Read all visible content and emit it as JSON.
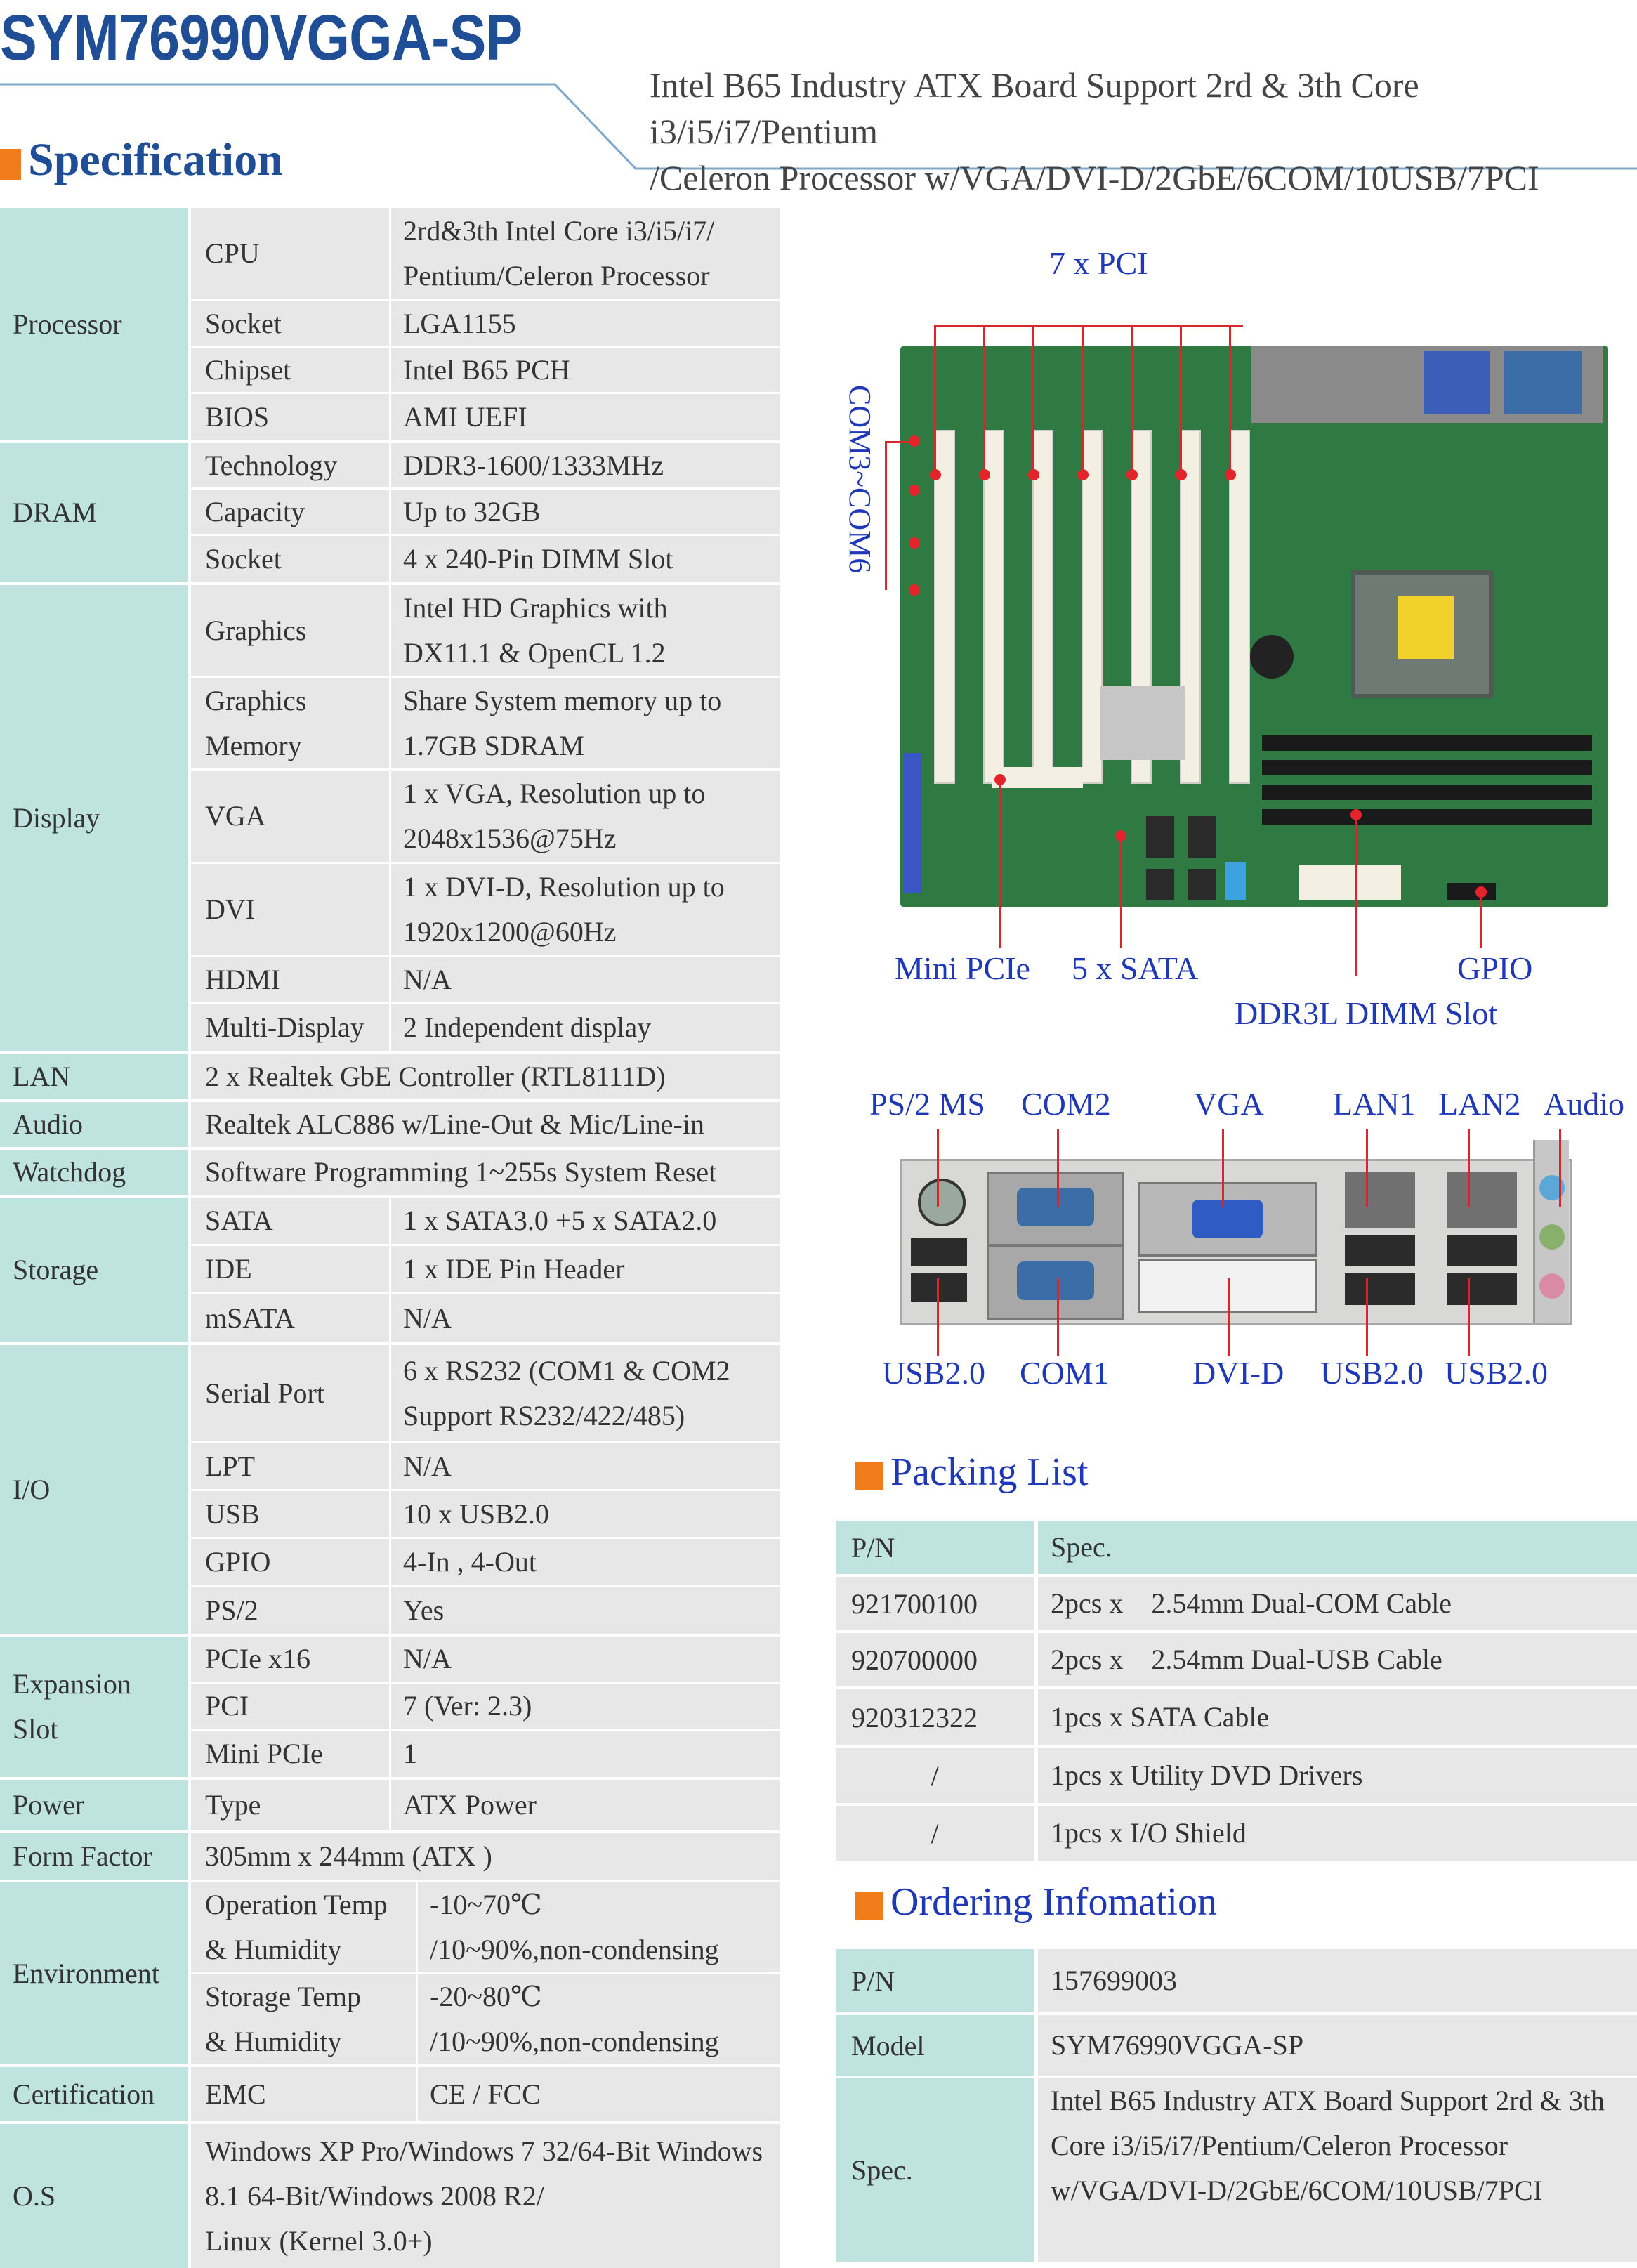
{
  "header": {
    "model_title": "SYM76990VGGA-SP",
    "subtitle_line1": "Intel B65 Industry ATX Board Support 2rd & 3th Core i3/i5/i7/Pentium",
    "subtitle_line2": "/Celeron Processor w/VGA/DVI-D/2GbE/6COM/10USB/7PCI",
    "spec_heading": "Specification"
  },
  "spec": {
    "processor": {
      "label": "Processor",
      "cpu_name": "CPU",
      "cpu_v1": "2rd&3th Intel Core i3/i5/i7/",
      "cpu_v2": "Pentium/Celeron Processor",
      "socket_name": "Socket",
      "socket_val": "LGA1155",
      "chipset_name": "Chipset",
      "chipset_val": "Intel B65 PCH",
      "bios_name": "BIOS",
      "bios_val": "AMI UEFI"
    },
    "dram": {
      "label": "DRAM",
      "tech_name": "Technology",
      "tech_val": "DDR3-1600/1333MHz",
      "cap_name": "Capacity",
      "cap_val": "Up to 32GB",
      "socket_name": "Socket",
      "socket_val": "4 x 240-Pin DIMM Slot"
    },
    "display": {
      "label": "Display",
      "gfx_name": "Graphics",
      "gfx_v1": "Intel HD Graphics with",
      "gfx_v2": "DX11.1 & OpenCL 1.2",
      "gmem_n1": "Graphics",
      "gmem_n2": "Memory",
      "gmem_v1": "Share System memory up to",
      "gmem_v2": "1.7GB SDRAM",
      "vga_name": "VGA",
      "vga_v1": "1 x VGA, Resolution up to",
      "vga_v2": "2048x1536@75Hz",
      "dvi_name": "DVI",
      "dvi_v1": "1 x DVI-D, Resolution up to",
      "dvi_v2": "1920x1200@60Hz",
      "hdmi_name": "HDMI",
      "hdmi_val": "N/A",
      "multi_name": "Multi-Display",
      "multi_val": "2 Independent display"
    },
    "lan": {
      "label": "LAN",
      "val": "2 x Realtek GbE Controller (RTL8111D)"
    },
    "audio": {
      "label": "Audio",
      "val": "Realtek ALC886 w/Line-Out & Mic/Line-in"
    },
    "watchdog": {
      "label": "Watchdog",
      "val": "Software Programming 1~255s System Reset"
    },
    "storage": {
      "label": "Storage",
      "sata_name": "SATA",
      "sata_val": "1 x SATA3.0 +5 x SATA2.0",
      "ide_name": "IDE",
      "ide_val": "1 x IDE Pin Header",
      "msata_name": "mSATA",
      "msata_val": "N/A"
    },
    "io": {
      "label": "I/O",
      "serial_name": "Serial Port",
      "serial_v1": "6 x RS232 (COM1 & COM2",
      "serial_v2": "Support RS232/422/485)",
      "lpt_name": "LPT",
      "lpt_val": "N/A",
      "usb_name": "USB",
      "usb_val": "10 x USB2.0",
      "gpio_name": "GPIO",
      "gpio_val": "4-In , 4-Out",
      "ps2_name": "PS/2",
      "ps2_val": "Yes"
    },
    "expansion": {
      "label1": "Expansion",
      "label2": "Slot",
      "pcie_name": "PCIe x16",
      "pcie_val": "N/A",
      "pci_name": "PCI",
      "pci_val": "7 (Ver: 2.3)",
      "minipcie_name": "Mini PCIe",
      "minipcie_val": "1"
    },
    "power": {
      "label": "Power",
      "type_name": "Type",
      "type_val": "ATX Power"
    },
    "form_factor": {
      "label": "Form Factor",
      "val": "305mm x 244mm (ATX )"
    },
    "environment": {
      "label": "Environment",
      "op_n1": "Operation Temp",
      "op_n2": "& Humidity",
      "op_v1": "-10~70℃",
      "op_v2": "/10~90%,non-condensing",
      "st_n1": "Storage Temp",
      "st_n2": "& Humidity",
      "st_v1": "-20~80℃",
      "st_v2": "/10~90%,non-condensing"
    },
    "certification": {
      "label": "Certification",
      "emc_name": "EMC",
      "emc_val": "CE / FCC"
    },
    "os": {
      "label": "O.S",
      "v1": "Windows XP Pro/Windows 7 32/64-Bit Windows",
      "v2": "8.1 64-Bit/Windows 2008 R2/",
      "v3": "Linux (Kernel 3.0+)"
    }
  },
  "board_labels": {
    "pci": "7 x PCI",
    "com": "COM3~COM6",
    "minipcie": "Mini PCIe",
    "sata": "5 x SATA",
    "gpio": "GPIO",
    "dimm": "DDR3L DIMM Slot"
  },
  "io_labels": {
    "ps2": "PS/2 MS",
    "com2": "COM2",
    "vga": "VGA",
    "lan1": "LAN1",
    "lan2": "LAN2",
    "audio": "Audio",
    "usb_a": "USB2.0",
    "com1": "COM1",
    "dvi": "DVI-D",
    "usb_b": "USB2.0",
    "usb_c": "USB2.0"
  },
  "packing": {
    "heading": "Packing List",
    "col1": "P/N",
    "col2": "Spec.",
    "rows": [
      {
        "pn": "921700100",
        "spec": "2pcs x    2.54mm Dual-COM Cable"
      },
      {
        "pn": "920700000",
        "spec": "2pcs x    2.54mm Dual-USB Cable"
      },
      {
        "pn": "920312322",
        "spec": "1pcs x SATA Cable"
      },
      {
        "pn": "/",
        "spec": "1pcs x Utility DVD Drivers"
      },
      {
        "pn": "/",
        "spec": "1pcs x I/O Shield"
      }
    ]
  },
  "ordering": {
    "heading": "Ordering Infomation",
    "pn_label": "P/N",
    "pn_val": "157699003",
    "model_label": "Model",
    "model_val": "SYM76990VGGA-SP",
    "spec_label": "Spec.",
    "spec_v1": "Intel B65 Industry ATX Board Support 2rd & 3th",
    "spec_v2": "Core i3/i5/i7/Pentium/Celeron Processor",
    "spec_v3": "w/VGA/DVI-D/2GbE/6COM/10USB/7PCI"
  },
  "colors": {
    "brand_blue": "#1f4e96",
    "label_blue": "#1f38b8",
    "accent_orange": "#f07d1a",
    "teal_cell": "#bfe3df",
    "grey_cell": "#e7e7e7",
    "pointer_red": "#d9252b"
  }
}
